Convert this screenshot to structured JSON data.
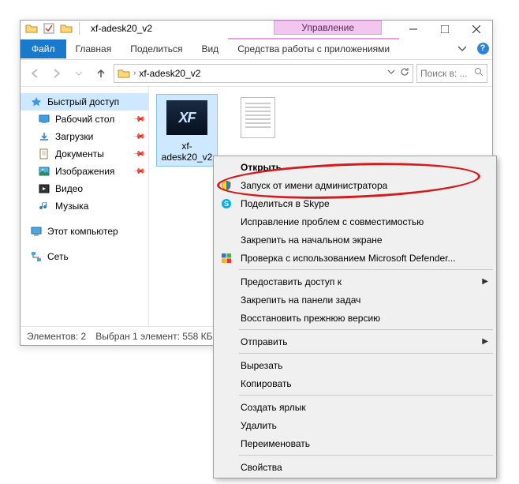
{
  "window": {
    "title": "xf-adesk20_v2",
    "contextual_tab_header": "Управление"
  },
  "ribbon": {
    "file": "Файл",
    "tabs": [
      "Главная",
      "Поделиться",
      "Вид"
    ],
    "contextual": "Средства работы с приложениями"
  },
  "breadcrumb": {
    "item": "xf-adesk20_v2"
  },
  "search": {
    "placeholder": "Поиск в: ..."
  },
  "sidebar": {
    "quick": "Быстрый доступ",
    "items": [
      {
        "label": "Рабочий стол",
        "icon": "desktop"
      },
      {
        "label": "Загрузки",
        "icon": "downloads"
      },
      {
        "label": "Документы",
        "icon": "documents"
      },
      {
        "label": "Изображения",
        "icon": "pictures"
      },
      {
        "label": "Видео",
        "icon": "video"
      },
      {
        "label": "Музыка",
        "icon": "music"
      }
    ],
    "pc": "Этот компьютер",
    "network": "Сеть"
  },
  "files": [
    {
      "name": "xf-adesk20_v2",
      "type": "exe",
      "selected": true
    },
    {
      "name": "",
      "type": "txt",
      "selected": false
    }
  ],
  "status": {
    "count": "Элементов: 2",
    "selection": "Выбран 1 элемент: 558 КБ"
  },
  "context_menu": {
    "items": [
      {
        "label": "Открыть",
        "bold": true
      },
      {
        "label": "Запуск от имени администратора",
        "icon": "shield"
      },
      {
        "label": "Поделиться в Skype",
        "icon": "skype"
      },
      {
        "label": "Исправление проблем с совместимостью"
      },
      {
        "label": "Закрепить на начальном экране"
      },
      {
        "label": "Проверка с использованием Microsoft Defender...",
        "icon": "defender"
      },
      {
        "sep": true
      },
      {
        "label": "Предоставить доступ к",
        "submenu": true
      },
      {
        "label": "Закрепить на панели задач"
      },
      {
        "label": "Восстановить прежнюю версию"
      },
      {
        "sep": true
      },
      {
        "label": "Отправить",
        "submenu": true
      },
      {
        "sep": true
      },
      {
        "label": "Вырезать"
      },
      {
        "label": "Копировать"
      },
      {
        "sep": true
      },
      {
        "label": "Создать ярлык"
      },
      {
        "label": "Удалить"
      },
      {
        "label": "Переименовать"
      },
      {
        "sep": true
      },
      {
        "label": "Свойства"
      }
    ]
  }
}
